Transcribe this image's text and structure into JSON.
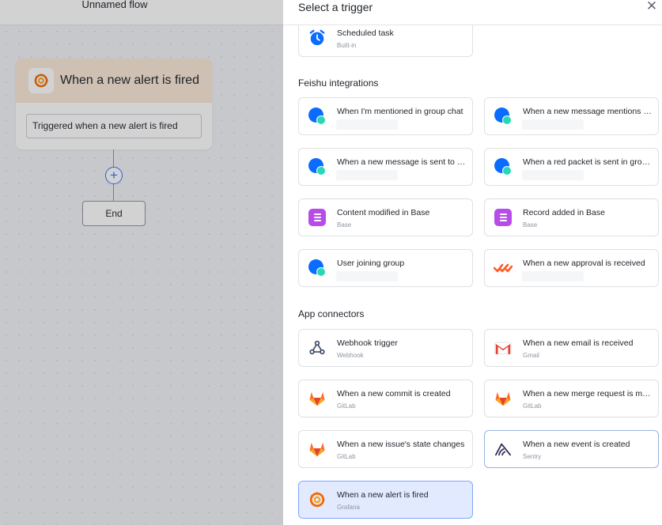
{
  "flow": {
    "title": "Unnamed flow",
    "trigger_node_title": "When a new alert is fired",
    "trigger_node_field": "Triggered when a new alert is fired",
    "end_label": "End",
    "add_step_symbol": "+"
  },
  "panel": {
    "title": "Select a trigger",
    "close_symbol": "✕",
    "scheduled": {
      "label": "Scheduled task",
      "sub": "Built-in",
      "icon": "alarm-clock-icon"
    },
    "feishu_section_title": "Feishu integrations",
    "feishu": [
      {
        "label": "When I'm mentioned in group chat",
        "icon": "feishu-chat-icon"
      },
      {
        "label": "When a new message mentions B...",
        "icon": "feishu-chat-icon"
      },
      {
        "label": "When a new message is sent to m...",
        "icon": "feishu-chat-icon"
      },
      {
        "label": "When a red packet is sent in group...",
        "icon": "feishu-chat-icon"
      },
      {
        "label": "Content modified in Base",
        "sub": "Base",
        "icon": "base-icon"
      },
      {
        "label": "Record added in Base",
        "sub": "Base",
        "icon": "base-icon"
      },
      {
        "label": "User joining group",
        "icon": "feishu-chat-icon"
      },
      {
        "label": "When a new approval is received",
        "icon": "approval-icon"
      }
    ],
    "app_section_title": "App connectors",
    "apps": [
      {
        "label": "Webhook trigger",
        "sub": "Webhook",
        "icon": "webhook-icon"
      },
      {
        "label": "When a new email is received",
        "sub": "Gmail",
        "icon": "gmail-icon"
      },
      {
        "label": "When a new commit is created",
        "sub": "GitLab",
        "icon": "gitlab-icon"
      },
      {
        "label": "When a new merge request is made",
        "sub": "GitLab",
        "icon": "gitlab-icon"
      },
      {
        "label": "When a new issue's state changes",
        "sub": "GitLab",
        "icon": "gitlab-icon"
      },
      {
        "label": "When a new event is created",
        "sub": "Sentry",
        "icon": "sentry-icon"
      },
      {
        "label": "When a new alert is fired",
        "sub": "Grafana",
        "icon": "grafana-icon"
      }
    ]
  },
  "colors": {
    "accent": "#3370ff",
    "selected_bg": "#e1eaff",
    "trigger_header_bg": "#fbe9d7"
  }
}
